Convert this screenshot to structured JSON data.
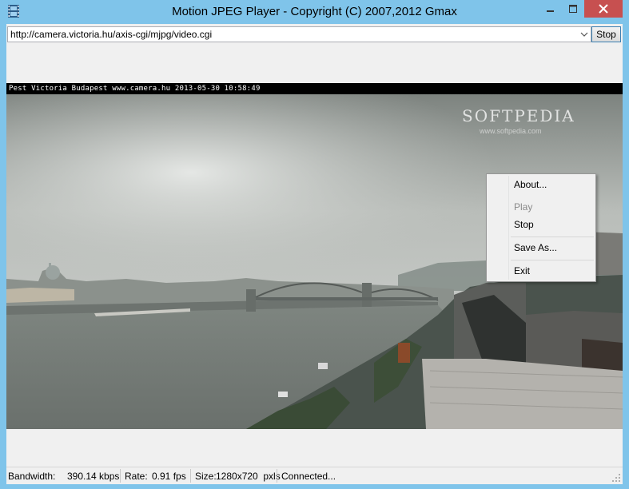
{
  "window": {
    "title": "Motion JPEG Player - Copyright (C) 2007,2012 Gmax",
    "close_glyph": "✕",
    "min_glyph": "—",
    "max_glyph": "☐"
  },
  "toolbar": {
    "url_value": "http://camera.victoria.hu/axis-cgi/mjpg/video.cgi",
    "stop_label": "Stop"
  },
  "video": {
    "overlay_text": "Pest Victoria Budapest  www.camera.hu  2013-05-30 10:58:49",
    "watermark": "SOFTPEDIA",
    "watermark_sub": "www.softpedia.com"
  },
  "context_menu": {
    "items": [
      {
        "label": "About...",
        "enabled": true
      },
      {
        "label": "Play",
        "enabled": false
      },
      {
        "label": "Stop",
        "enabled": true
      },
      {
        "label": "Save As...",
        "enabled": true
      },
      {
        "label": "Exit",
        "enabled": true
      }
    ]
  },
  "statusbar": {
    "bandwidth_label": "Bandwidth:",
    "bandwidth_value": "390.14 kbps",
    "rate_label": "Rate:",
    "rate_value": "0.91 fps",
    "size_label": "Size:",
    "size_value": "1280x720  pxls",
    "status": "Connected..."
  },
  "colors": {
    "titlebar": "#7fc4ea",
    "close_button": "#c75050"
  },
  "icons": [
    "film-strip-icon",
    "minimize-icon",
    "maximize-icon",
    "close-icon",
    "dropdown-arrow-icon"
  ]
}
